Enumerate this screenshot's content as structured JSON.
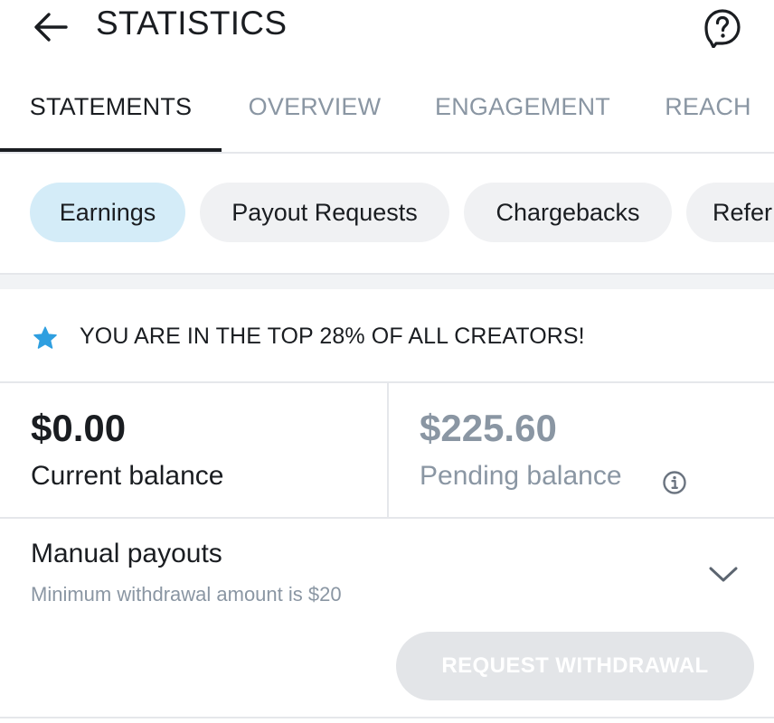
{
  "header": {
    "title": "STATISTICS"
  },
  "tabs": [
    {
      "label": "STATEMENTS",
      "active": true
    },
    {
      "label": "OVERVIEW",
      "active": false
    },
    {
      "label": "ENGAGEMENT",
      "active": false
    },
    {
      "label": "REACH",
      "active": false
    }
  ],
  "chips": [
    {
      "label": "Earnings",
      "active": true
    },
    {
      "label": "Payout Requests",
      "active": false
    },
    {
      "label": "Chargebacks",
      "active": false
    },
    {
      "label": "Refer",
      "active": false
    }
  ],
  "banner": {
    "text": "YOU ARE IN THE TOP 28% OF ALL CREATORS!",
    "icon": "star-icon"
  },
  "balances": {
    "current": {
      "amount": "$0.00",
      "label": "Current balance"
    },
    "pending": {
      "amount": "$225.60",
      "label": "Pending balance"
    }
  },
  "payouts": {
    "title": "Manual payouts",
    "subtitle": "Minimum withdrawal amount is $20",
    "button_label": "REQUEST WITHDRAWAL"
  },
  "colors": {
    "accent_chip": "#d4ecf8",
    "star": "#2f9fe0",
    "muted_text": "#8a96a3",
    "disabled_button": "#e3e5e8"
  }
}
